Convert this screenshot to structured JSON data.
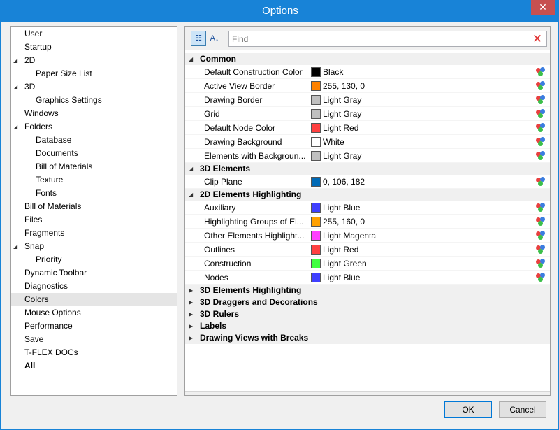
{
  "window": {
    "title": "Options",
    "close_glyph": "✕"
  },
  "tree": [
    {
      "label": "User",
      "indent": 0,
      "arrow": ""
    },
    {
      "label": "Startup",
      "indent": 0,
      "arrow": ""
    },
    {
      "label": "2D",
      "indent": 0,
      "arrow": "◢"
    },
    {
      "label": "Paper Size List",
      "indent": 1,
      "arrow": ""
    },
    {
      "label": "3D",
      "indent": 0,
      "arrow": "◢"
    },
    {
      "label": "Graphics Settings",
      "indent": 1,
      "arrow": ""
    },
    {
      "label": "Windows",
      "indent": 0,
      "arrow": ""
    },
    {
      "label": "Folders",
      "indent": 0,
      "arrow": "◢"
    },
    {
      "label": "Database",
      "indent": 1,
      "arrow": ""
    },
    {
      "label": "Documents",
      "indent": 1,
      "arrow": ""
    },
    {
      "label": "Bill of Materials",
      "indent": 1,
      "arrow": ""
    },
    {
      "label": "Texture",
      "indent": 1,
      "arrow": ""
    },
    {
      "label": "Fonts",
      "indent": 1,
      "arrow": ""
    },
    {
      "label": "Bill of Materials",
      "indent": 0,
      "arrow": ""
    },
    {
      "label": "Files",
      "indent": 0,
      "arrow": ""
    },
    {
      "label": "Fragments",
      "indent": 0,
      "arrow": ""
    },
    {
      "label": "Snap",
      "indent": 0,
      "arrow": "◢"
    },
    {
      "label": "Priority",
      "indent": 1,
      "arrow": ""
    },
    {
      "label": "Dynamic Toolbar",
      "indent": 0,
      "arrow": ""
    },
    {
      "label": "Diagnostics",
      "indent": 0,
      "arrow": ""
    },
    {
      "label": "Colors",
      "indent": 0,
      "arrow": "",
      "selected": true
    },
    {
      "label": "Mouse Options",
      "indent": 0,
      "arrow": ""
    },
    {
      "label": "Performance",
      "indent": 0,
      "arrow": ""
    },
    {
      "label": "Save",
      "indent": 0,
      "arrow": ""
    },
    {
      "label": "T-FLEX DOCs",
      "indent": 0,
      "arrow": ""
    },
    {
      "label": "All",
      "indent": 0,
      "arrow": "",
      "bold": true
    }
  ],
  "toolbar": {
    "categorized_glyph": "☷",
    "alpha_glyph": "A↓",
    "find_placeholder": "Find",
    "find_value": "",
    "clear_glyph": "✕"
  },
  "grid": [
    {
      "type": "cat",
      "label": "Common",
      "expanded": true
    },
    {
      "type": "prop",
      "name": "Default Construction Color",
      "value": "Black",
      "color": "#000000"
    },
    {
      "type": "prop",
      "name": "Active View Border",
      "value": "255, 130, 0",
      "color": "#ff8200"
    },
    {
      "type": "prop",
      "name": "Drawing Border",
      "value": "Light Gray",
      "color": "#c0c0c0"
    },
    {
      "type": "prop",
      "name": "Grid",
      "value": "Light Gray",
      "color": "#c0c0c0"
    },
    {
      "type": "prop",
      "name": "Default Node Color",
      "value": "Light Red",
      "color": "#ff4040"
    },
    {
      "type": "prop",
      "name": "Drawing Background",
      "value": "White",
      "color": "#ffffff"
    },
    {
      "type": "prop",
      "name": "Elements with Backgroun...",
      "value": "Light Gray",
      "color": "#c0c0c0"
    },
    {
      "type": "cat",
      "label": "3D Elements",
      "expanded": true
    },
    {
      "type": "prop",
      "name": "Clip Plane",
      "value": "0, 106, 182",
      "color": "#006ab6"
    },
    {
      "type": "cat",
      "label": "2D Elements Highlighting",
      "expanded": true
    },
    {
      "type": "prop",
      "name": "Auxiliary",
      "value": "Light Blue",
      "color": "#4040ff"
    },
    {
      "type": "prop",
      "name": "Highlighting Groups of El...",
      "value": "255, 160, 0",
      "color": "#ffa000"
    },
    {
      "type": "prop",
      "name": "Other Elements Highlight...",
      "value": "Light Magenta",
      "color": "#ff40ff"
    },
    {
      "type": "prop",
      "name": "Outlines",
      "value": "Light Red",
      "color": "#ff4040"
    },
    {
      "type": "prop",
      "name": "Construction",
      "value": "Light Green",
      "color": "#40ff40"
    },
    {
      "type": "prop",
      "name": "Nodes",
      "value": "Light Blue",
      "color": "#4040ff"
    },
    {
      "type": "cat",
      "label": "3D Elements Highlighting",
      "expanded": false
    },
    {
      "type": "cat",
      "label": "3D Draggers and Decorations",
      "expanded": false
    },
    {
      "type": "cat",
      "label": "3D Rulers",
      "expanded": false
    },
    {
      "type": "cat",
      "label": "Labels",
      "expanded": false
    },
    {
      "type": "cat",
      "label": "Drawing Views with Breaks",
      "expanded": false
    }
  ],
  "buttons": {
    "ok": "OK",
    "cancel": "Cancel"
  },
  "colors": {
    "titlebar": "#1883d7",
    "close": "#c75050",
    "selection": "#e5e5e5"
  }
}
